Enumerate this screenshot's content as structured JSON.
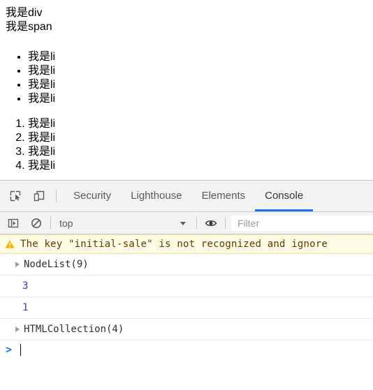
{
  "page": {
    "div_text": "我是div",
    "span_text": "我是span",
    "unordered_list": [
      "我是li",
      "我是li",
      "我是li",
      "我是li"
    ],
    "ordered_list": [
      "我是li",
      "我是li",
      "我是li",
      "我是li"
    ]
  },
  "devtools": {
    "tabbar": {
      "inspect_icon": "inspect-element-icon",
      "device_icon": "device-toolbar-icon",
      "tabs": [
        {
          "label": "Security",
          "active": false
        },
        {
          "label": "Lighthouse",
          "active": false
        },
        {
          "label": "Elements",
          "active": false
        },
        {
          "label": "Console",
          "active": true
        }
      ],
      "active_underline_color": "#1a73e8"
    },
    "console_toolbar": {
      "sidebar_toggle_icon": "console-sidebar-icon",
      "clear_icon": "clear-console-icon",
      "context_selector": {
        "value": "top",
        "caret_icon": "chevron-down-icon"
      },
      "eye_icon": "live-expression-eye-icon",
      "filter": {
        "value": "",
        "placeholder": "Filter"
      }
    },
    "console_messages": [
      {
        "type": "warning",
        "icon": "warning-triangle-icon",
        "text": "The key \"initial-sale\" is not recognized and ignore",
        "bg": "#fffbe5"
      },
      {
        "type": "result",
        "expandable": true,
        "text": "NodeList(9)"
      },
      {
        "type": "result",
        "expandable": false,
        "value": "3",
        "value_color": "#3a35c8"
      },
      {
        "type": "result",
        "expandable": false,
        "value": "1",
        "value_color": "#3a35c8"
      },
      {
        "type": "result",
        "expandable": true,
        "text": "HTMLCollection(4)"
      }
    ],
    "prompt": {
      "chevron": ">",
      "input_value": ""
    }
  }
}
